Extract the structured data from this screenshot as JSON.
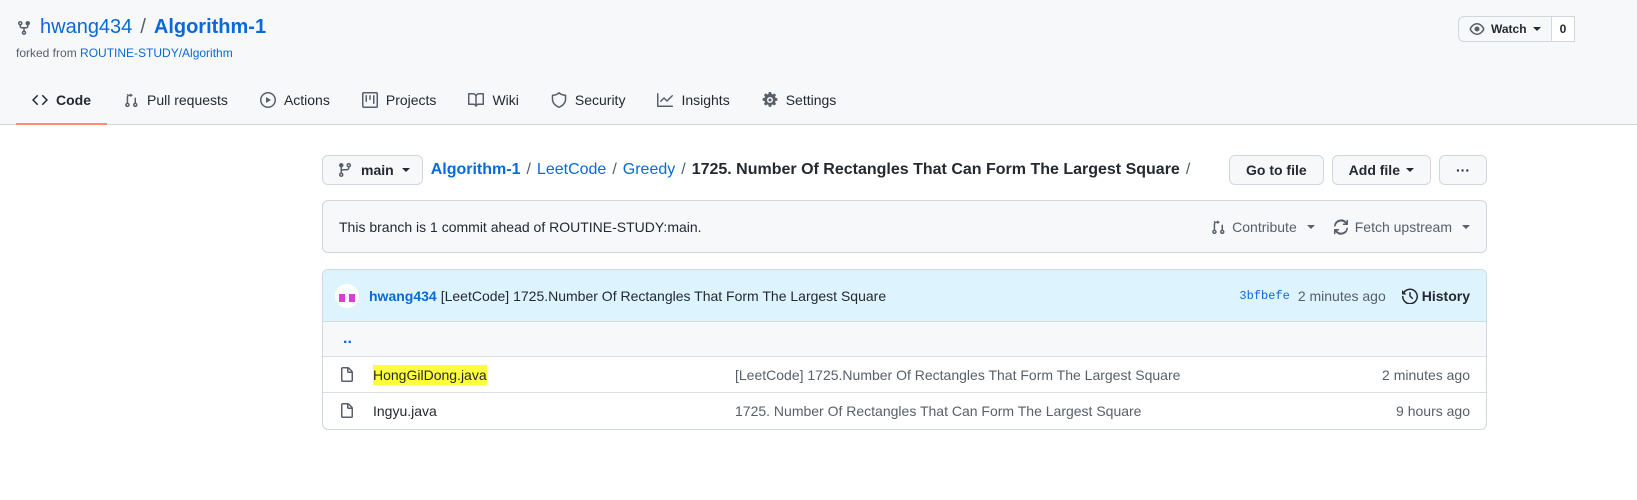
{
  "repo": {
    "owner": "hwang434",
    "separator": "/",
    "name": "Algorithm-1",
    "forked_prefix": "forked from",
    "forked_from": "ROUTINE-STUDY/Algorithm",
    "watch_label": "Watch",
    "watch_count": "0"
  },
  "nav": {
    "tabs": [
      {
        "label": "Code",
        "icon": "code-icon",
        "active": true
      },
      {
        "label": "Pull requests",
        "icon": "pull-request-icon"
      },
      {
        "label": "Actions",
        "icon": "play-icon"
      },
      {
        "label": "Projects",
        "icon": "project-icon"
      },
      {
        "label": "Wiki",
        "icon": "book-icon"
      },
      {
        "label": "Security",
        "icon": "shield-icon"
      },
      {
        "label": "Insights",
        "icon": "graph-icon"
      },
      {
        "label": "Settings",
        "icon": "gear-icon"
      }
    ]
  },
  "toolbar": {
    "branch": "main",
    "breadcrumb": [
      "Algorithm-1",
      "LeetCode",
      "Greedy",
      "1725. Number Of Rectangles That Can Form The Largest Square"
    ],
    "sep": "/",
    "go_to_file": "Go to file",
    "add_file": "Add file",
    "more": "···"
  },
  "branch_status": {
    "text": "This branch is 1 commit ahead of ROUTINE-STUDY:main.",
    "contribute": "Contribute",
    "fetch_upstream": "Fetch upstream"
  },
  "latest_commit": {
    "author": "hwang434",
    "message": "[LeetCode] 1725.Number Of Rectangles That Form The Largest Square",
    "sha": "3bfbefe",
    "time": "2 minutes ago",
    "history": "History"
  },
  "files": {
    "up": "..",
    "rows": [
      {
        "name": "HongGilDong.java",
        "message": "[LeetCode] 1725.Number Of Rectangles That Form The Largest Square",
        "age": "2 minutes ago",
        "highlight": true
      },
      {
        "name": "Ingyu.java",
        "message": "1725. Number Of Rectangles That Can Form The Largest Square",
        "age": "9 hours ago"
      }
    ]
  },
  "colors": {
    "link": "#0969da",
    "active_tab_underline": "#fd8c73",
    "highlight": "#ffff3b",
    "commit_header_bg": "#ddf4ff"
  }
}
